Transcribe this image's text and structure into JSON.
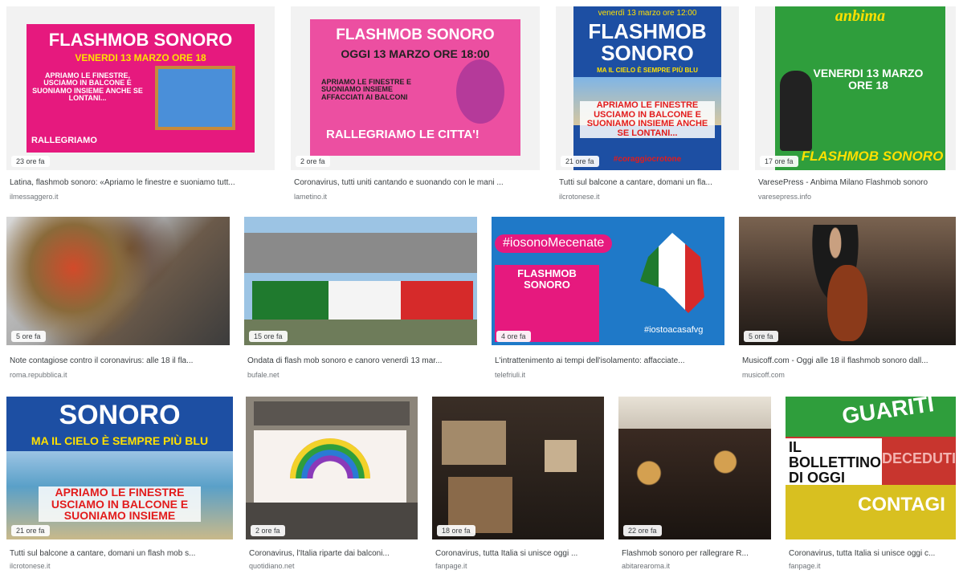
{
  "results": [
    {
      "title": "Latina, flashmob sonoro: «Apriamo le finestre e suoniamo tutt...",
      "source": "ilmessaggero.it",
      "time": "23 ore fa",
      "headline": "FLASHMOB SONORO",
      "sub": "VENERDI 13 MARZO ORE 18",
      "body": "APRIAMO LE FINESTRE, USCIAMO IN BALCONE E SUONIAMO INSIEME ANCHE SE LONTANI...",
      "foot": "RALLEGRIAMO"
    },
    {
      "title": "Coronavirus, tutti uniti cantando e suonando con le mani ...",
      "source": "lametino.it",
      "time": "2 ore fa",
      "headline": "FLASHMOB SONORO",
      "sub": "OGGI 13 MARZO ORE 18:00",
      "body": "APRIAMO LE FINESTRE E SUONIAMO INSIEME AFFACCIATI AI BALCONI",
      "foot": "RALLEGRIAMO LE CITTA'!"
    },
    {
      "title": "Tutti sul balcone a cantare, domani un fla...",
      "source": "ilcrotonese.it",
      "time": "21 ore fa",
      "top": "venerdì 13 marzo ore 12:00",
      "headline": "FLASHMOB SONORO",
      "sub": "MA IL CIELO È SEMPRE PIÙ BLU",
      "body": "APRIAMO LE FINESTRE USCIAMO IN BALCONE E SUONIAMO INSIEME ANCHE SE LONTANI...",
      "foot": "#coraggiocrotone"
    },
    {
      "title": "VaresePress - Anbima Milano Flashmob sonoro",
      "source": "varesepress.info",
      "time": "17 ore fa",
      "top": "anbima",
      "headline": "VENERDI 13 MARZO ORE 18",
      "foot": "FLASHMOB SONORO"
    },
    {
      "title": "Note contagiose contro il coronavirus: alle 18 il fla...",
      "source": "roma.repubblica.it",
      "time": "5 ore fa"
    },
    {
      "title": "Ondata di flash mob sonoro e canoro venerdì 13 mar...",
      "source": "bufale.net",
      "time": "15 ore fa"
    },
    {
      "title": "L'intrattenimento ai tempi dell'isolamento: affacciate...",
      "source": "telefriuli.it",
      "time": "4 ore fa",
      "top": "#iosonoMecenate",
      "headline": "FLASHMOB SONORO",
      "foot": "#iostoacasafvg"
    },
    {
      "title": "Musicoff.com - Oggi alle 18 il flashmob sonoro dall...",
      "source": "musicoff.com",
      "time": "5 ore fa"
    },
    {
      "title": "Tutti sul balcone a cantare, domani un flash mob s...",
      "source": "ilcrotonese.it",
      "time": "21 ore fa",
      "headline": "SONORO",
      "sub": "MA IL CIELO È SEMPRE PIÙ BLU",
      "body": "APRIAMO LE FINESTRE USCIAMO IN BALCONE E SUONIAMO INSIEME"
    },
    {
      "title": "Coronavirus, l'Italia riparte dai balconi...",
      "source": "quotidiano.net",
      "time": "2 ore fa"
    },
    {
      "title": "Coronavirus, tutta Italia si unisce oggi ...",
      "source": "fanpage.it",
      "time": "18 ore fa"
    },
    {
      "title": "Flashmob sonoro per rallegrare R...",
      "source": "abitarearoma.it",
      "time": "22 ore fa"
    },
    {
      "title": "Coronavirus, tutta Italia si unisce oggi c...",
      "source": "fanpage.it",
      "time": "",
      "headline": "GUARITI",
      "sub": "IL BOLLETTINO DI OGGI",
      "body": "DECEDUTI",
      "foot": "CONTAGI"
    }
  ],
  "colors": {
    "pink": "#e6197e",
    "blue": "#1d4fa3",
    "green": "#2f9e3c",
    "sky": "#3a7bd5"
  }
}
